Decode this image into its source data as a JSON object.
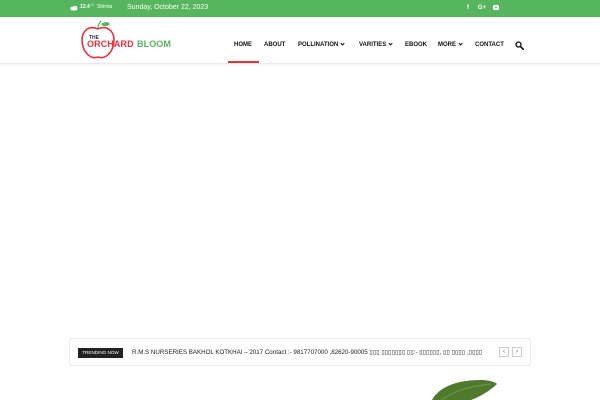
{
  "topbar": {
    "temperature": "12.4",
    "temperature_unit": "C",
    "location": "Shimla",
    "date": "Sunday, October 22, 2023",
    "social": [
      {
        "name": "facebook",
        "glyph": "f"
      },
      {
        "name": "google-plus",
        "glyph": "G+"
      },
      {
        "name": "youtube",
        "glyph": "youtube-icon"
      }
    ]
  },
  "logo": {
    "the": "THE",
    "orchard": "ORCHARD",
    "bloom": "BLOOM"
  },
  "nav": {
    "items": [
      {
        "label": "HOME",
        "dropdown": false
      },
      {
        "label": "ABOUT",
        "dropdown": false
      },
      {
        "label": "POLLINATION",
        "dropdown": true
      },
      {
        "label": "VARITIES",
        "dropdown": true
      },
      {
        "label": "EBOOK",
        "dropdown": false
      },
      {
        "label": "MORE",
        "dropdown": true
      },
      {
        "label": "CONTACT",
        "dropdown": false
      }
    ]
  },
  "trending": {
    "label": "TRENDING NOW",
    "text": "R.M.S NURSERIES BAKHOL KOTKHAI – 2017 Contact :- 9817707000 ,82620-90005 ▯▯▯ ▯▯▯▯▯▯▯ ▯▯:- ▯▯▯▯▯▯, ▯▯ ▯▯▯▯ ,▯▯▯▯",
    "prev_glyph": "‹",
    "next_glyph": "›"
  },
  "colors": {
    "brand_green": "#56b55e",
    "brand_red": "#e8323c",
    "leaf_green": "#4f7a2d"
  }
}
